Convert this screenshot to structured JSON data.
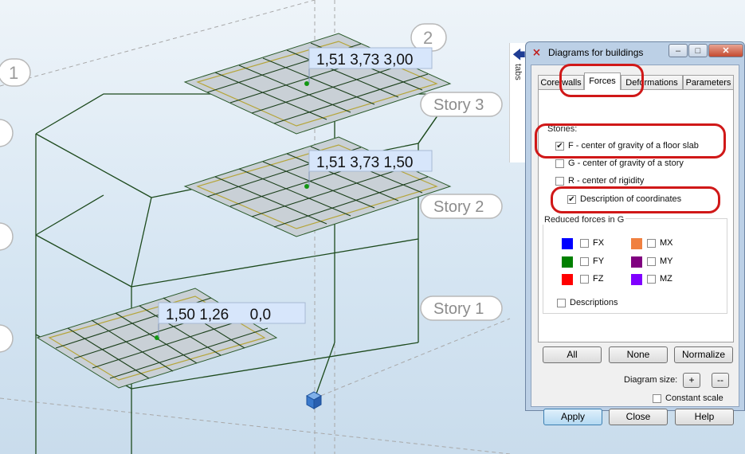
{
  "model": {
    "axes": [
      "1",
      "2"
    ],
    "stories": [
      "Story 3",
      "Story 2",
      "Story 1"
    ],
    "coordinate_labels": {
      "story3": "1,51 3,73 3,00",
      "story2": "1,51 3,73 1,50",
      "story1": "1,50 1,26     0,0"
    }
  },
  "tabs_panel": {
    "label": "tabs",
    "arrow": "arrow-left-icon"
  },
  "dialog": {
    "title": "Diagrams for buildings",
    "app_icon": "app-logo-icon",
    "tabs": [
      "Core walls",
      "Forces",
      "Deformations",
      "Parameters"
    ],
    "active_tab": "Forces",
    "stories_label": "Stories:",
    "stories": [
      {
        "label": "F - center of gravity of a floor slab",
        "checked": true
      },
      {
        "label": "G - center of gravity of a story",
        "checked": false
      },
      {
        "label": "R - center of rigidity",
        "checked": false
      },
      {
        "label": "Description of coordinates",
        "checked": true
      }
    ],
    "reduced_forces_label": "Reduced forces in G",
    "forces": [
      {
        "label": "FX",
        "color": "#0000ff",
        "checked": false
      },
      {
        "label": "FY",
        "color": "#008000",
        "checked": false
      },
      {
        "label": "FZ",
        "color": "#ff0000",
        "checked": false
      },
      {
        "label": "MX",
        "color": "#f08040",
        "checked": false
      },
      {
        "label": "MY",
        "color": "#800080",
        "checked": false
      },
      {
        "label": "MZ",
        "color": "#8000ff",
        "checked": false
      }
    ],
    "descriptions_label": "Descriptions",
    "buttons": {
      "all": "All",
      "none": "None",
      "normalize": "Normalize",
      "apply": "Apply",
      "close": "Close",
      "help": "Help",
      "plus": "+",
      "minus": "--"
    },
    "diagram_size_label": "Diagram size:",
    "constant_scale_label": "Constant scale",
    "highlight_color": "#d01818"
  }
}
